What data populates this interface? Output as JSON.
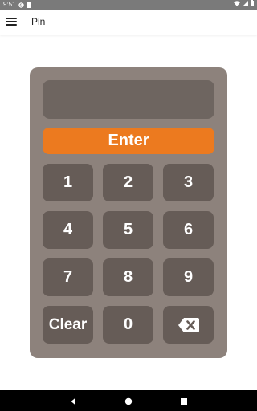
{
  "status_bar": {
    "time": "9:51",
    "icons": [
      "notification-g-icon",
      "sim-card-icon",
      "wifi-icon",
      "signal-icon",
      "battery-icon"
    ]
  },
  "app_bar": {
    "menu_icon": "hamburger-menu-icon",
    "title": "Pin"
  },
  "keypad": {
    "display_value": "",
    "enter_label": "Enter",
    "keys": [
      "1",
      "2",
      "3",
      "4",
      "5",
      "6",
      "7",
      "8",
      "9",
      "Clear",
      "0"
    ],
    "backspace_icon": "backspace-icon"
  },
  "nav_bar": {
    "icons": [
      "back-icon",
      "home-icon",
      "recents-icon"
    ]
  },
  "colors": {
    "keypad_bg": "#8d827c",
    "key_bg": "#665c57",
    "display_bg": "#6e6560",
    "accent": "#ec7a1f"
  }
}
